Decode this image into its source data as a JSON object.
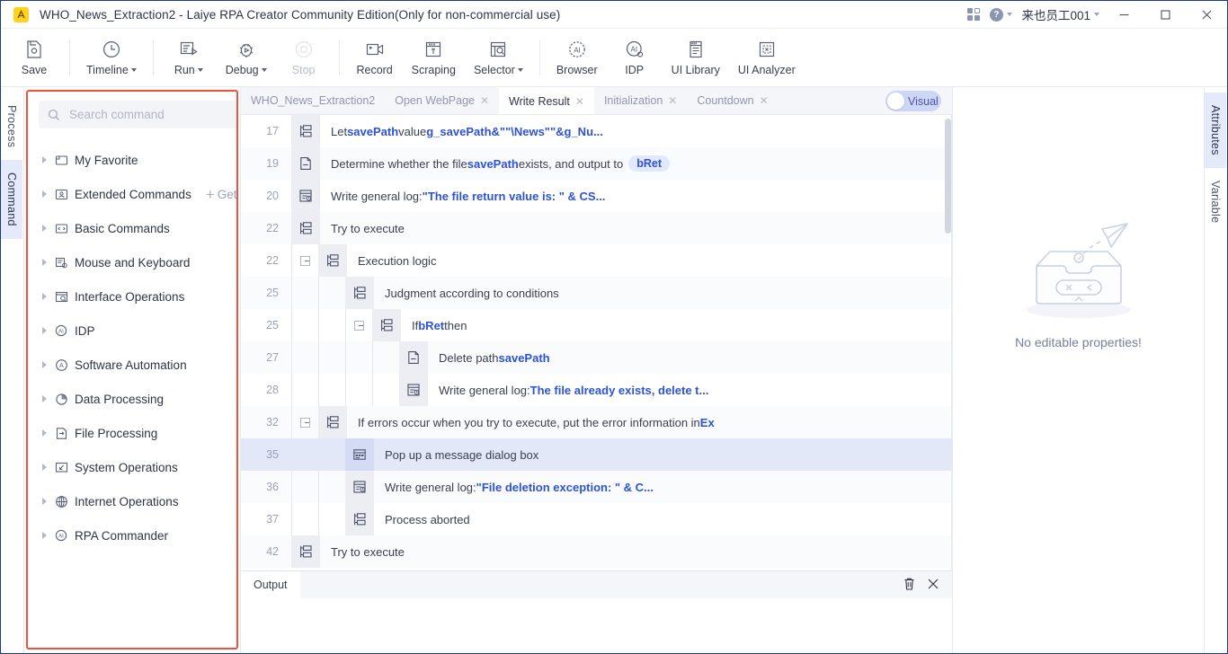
{
  "titlebar": {
    "logo_icon": "app-logo-icon",
    "title": "WHO_News_Extraction2 - Laiye RPA Creator Community Edition(Only for non-commercial use)",
    "apps_icon": "grid-apps-icon",
    "help_icon": "help-circle-icon",
    "user": "来也员工001",
    "minimize": "minimize-icon",
    "maximize": "maximize-icon",
    "close": "close-icon"
  },
  "toolbar": {
    "items": [
      {
        "label": "Save",
        "icon": "save-icon",
        "caret": false,
        "disabled": false
      },
      {
        "label": "Timeline",
        "icon": "clock-icon",
        "caret": true,
        "disabled": false
      },
      {
        "label": "Run",
        "icon": "run-icon",
        "caret": true,
        "disabled": false
      },
      {
        "label": "Debug",
        "icon": "bug-icon",
        "caret": true,
        "disabled": false
      },
      {
        "label": "Stop",
        "icon": "stop-icon",
        "caret": false,
        "disabled": true
      },
      {
        "label": "Record",
        "icon": "camera-icon",
        "caret": false,
        "disabled": false
      },
      {
        "label": "Scraping",
        "icon": "scraping-icon",
        "caret": false,
        "disabled": false
      },
      {
        "label": "Selector",
        "icon": "selector-icon",
        "caret": true,
        "disabled": false
      },
      {
        "label": "Browser",
        "icon": "ai-browser-icon",
        "caret": false,
        "disabled": false
      },
      {
        "label": "IDP",
        "icon": "ai-idp-icon",
        "caret": false,
        "disabled": false
      },
      {
        "label": "UI Library",
        "icon": "ui-library-icon",
        "caret": false,
        "disabled": false
      },
      {
        "label": "UI Analyzer",
        "icon": "ui-analyzer-icon",
        "caret": false,
        "disabled": false
      }
    ]
  },
  "left_rail": {
    "tabs": [
      {
        "label": "Process",
        "active": false
      },
      {
        "label": "Command",
        "active": true
      }
    ]
  },
  "command_panel": {
    "highlight_color": "#f4513b",
    "search": {
      "placeholder": "Search command",
      "value": "",
      "icon": "search-icon"
    },
    "filter_icon": "filter-dropdown-icon",
    "get_more_label": "Get",
    "items": [
      {
        "label": "My Favorite",
        "icon": "folder-icon"
      },
      {
        "label": "Extended Commands",
        "icon": "extension-icon",
        "has_get_more": true
      },
      {
        "label": "Basic Commands",
        "icon": "code-icon"
      },
      {
        "label": "Mouse and Keyboard",
        "icon": "keyboard-icon"
      },
      {
        "label": "Interface Operations",
        "icon": "window-search-icon"
      },
      {
        "label": "IDP",
        "icon": "ai-circle-icon"
      },
      {
        "label": "Software Automation",
        "icon": "a-circle-icon"
      },
      {
        "label": "Data Processing",
        "icon": "pie-chart-icon"
      },
      {
        "label": "File Processing",
        "icon": "file-arrow-icon"
      },
      {
        "label": "System Operations",
        "icon": "monitor-icon"
      },
      {
        "label": "Internet Operations",
        "icon": "globe-icon"
      },
      {
        "label": "RPA Commander",
        "icon": "ai-circle-icon"
      }
    ]
  },
  "process_tabs": {
    "tabs": [
      {
        "label": "WHO_News_Extraction2",
        "active": false,
        "closable": false
      },
      {
        "label": "Open WebPage",
        "active": false,
        "closable": true
      },
      {
        "label": "Write Result",
        "active": true,
        "closable": true
      },
      {
        "label": "Initialization",
        "active": false,
        "closable": true
      },
      {
        "label": "Countdown",
        "active": false,
        "closable": true
      }
    ],
    "visual_toggle": {
      "label": "Visual",
      "on": false
    }
  },
  "flow": {
    "rows": [
      {
        "line": "17",
        "indent": 0,
        "toggle": null,
        "icon": "sequence-icon",
        "selected": false,
        "segments": [
          {
            "t": "Let ",
            "b": false
          },
          {
            "t": "savePath",
            "b": true
          },
          {
            "t": " value ",
            "b": false
          },
          {
            "t": "g_savePath&\"\"\\News\"\"&g_Nu...",
            "b": true
          }
        ]
      },
      {
        "line": "19",
        "indent": 0,
        "toggle": null,
        "icon": "file-icon",
        "selected": false,
        "segments": [
          {
            "t": "Determine whether the file ",
            "b": false
          },
          {
            "t": "savePath",
            "b": true
          },
          {
            "t": " exists, and output to",
            "b": false
          }
        ],
        "chip": "bRet"
      },
      {
        "line": "20",
        "indent": 0,
        "toggle": null,
        "icon": "log-icon",
        "selected": false,
        "segments": [
          {
            "t": "Write general log: ",
            "b": false
          },
          {
            "t": "\"The file return value is: \" & CS...",
            "b": true
          }
        ]
      },
      {
        "line": "22",
        "indent": 0,
        "toggle": null,
        "icon": "sequence-icon",
        "selected": false,
        "segments": [
          {
            "t": "Try to execute",
            "b": false
          }
        ]
      },
      {
        "line": "22",
        "indent": 1,
        "toggle": "minus",
        "icon": "sequence-icon",
        "selected": false,
        "segments": [
          {
            "t": "Execution logic",
            "b": false
          }
        ]
      },
      {
        "line": "25",
        "indent": 2,
        "toggle": null,
        "icon": "sequence-icon",
        "selected": false,
        "segments": [
          {
            "t": "Judgment according to conditions",
            "b": false
          }
        ]
      },
      {
        "line": "25",
        "indent": 3,
        "toggle": "minus",
        "icon": "sequence-icon",
        "selected": false,
        "segments": [
          {
            "t": "If ",
            "b": false
          },
          {
            "t": "bRet",
            "b": true
          },
          {
            "t": " then",
            "b": false
          }
        ]
      },
      {
        "line": "27",
        "indent": 4,
        "toggle": null,
        "icon": "file-icon",
        "selected": false,
        "segments": [
          {
            "t": "Delete path ",
            "b": false
          },
          {
            "t": "savePath",
            "b": true
          }
        ]
      },
      {
        "line": "28",
        "indent": 4,
        "toggle": null,
        "icon": "log-icon",
        "selected": false,
        "segments": [
          {
            "t": "Write general log: ",
            "b": false
          },
          {
            "t": "The file already exists, delete t...",
            "b": true
          }
        ]
      },
      {
        "line": "32",
        "indent": 1,
        "toggle": "minus",
        "icon": "sequence-icon",
        "selected": false,
        "segments": [
          {
            "t": "If errors occur when you try to execute, put the error information in ",
            "b": false
          },
          {
            "t": "Ex",
            "b": true
          }
        ]
      },
      {
        "line": "35",
        "indent": 2,
        "toggle": null,
        "icon": "dialog-icon",
        "selected": true,
        "segments": [
          {
            "t": "Pop up a message dialog box",
            "b": false
          }
        ]
      },
      {
        "line": "36",
        "indent": 2,
        "toggle": null,
        "icon": "log-icon",
        "selected": false,
        "segments": [
          {
            "t": "Write general log: ",
            "b": false
          },
          {
            "t": "\"File deletion exception: \" & C...",
            "b": true
          }
        ]
      },
      {
        "line": "37",
        "indent": 2,
        "toggle": null,
        "icon": "sequence-icon",
        "selected": false,
        "segments": [
          {
            "t": "Process aborted",
            "b": false
          }
        ]
      },
      {
        "line": "42",
        "indent": 0,
        "toggle": null,
        "icon": "sequence-icon",
        "selected": false,
        "segments": [
          {
            "t": "Try to execute",
            "b": false
          }
        ]
      }
    ]
  },
  "output": {
    "tab_label": "Output",
    "clear_icon": "trash-icon",
    "close_icon": "close-icon",
    "content": ""
  },
  "right_panel": {
    "empty_illustration": "empty-tray-paperplane-icon",
    "empty_text": "No editable properties!",
    "tabs": [
      {
        "label": "Attributes",
        "active": true
      },
      {
        "label": "Variable",
        "active": false
      }
    ]
  }
}
